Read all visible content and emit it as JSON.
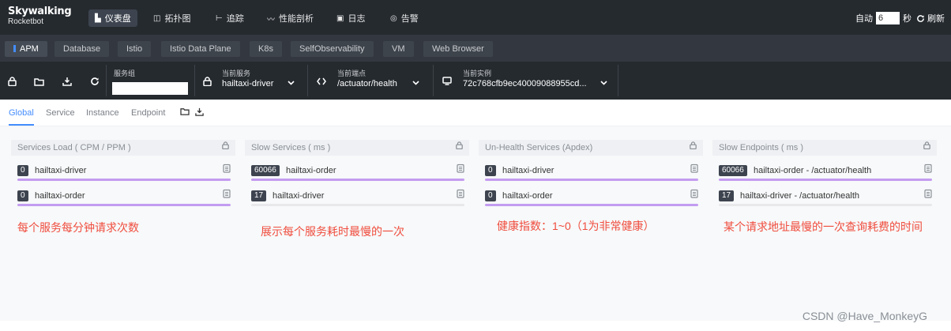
{
  "app": {
    "logo_main": "Skywalking",
    "logo_sub": "Rocketbot"
  },
  "nav": [
    {
      "icon": "▙",
      "label": "仪表盘",
      "active": true
    },
    {
      "icon": "◫",
      "label": "拓扑图",
      "active": false
    },
    {
      "icon": "⊢",
      "label": "追踪",
      "active": false
    },
    {
      "icon": "〰",
      "label": "性能剖析",
      "active": false
    },
    {
      "icon": "▣",
      "label": "日志",
      "active": false
    },
    {
      "icon": "◎",
      "label": "告警",
      "active": false
    }
  ],
  "auto_refresh": {
    "label": "自动",
    "interval": "6",
    "unit": "秒",
    "refresh_label": "刷新"
  },
  "layers": [
    "APM",
    "Database",
    "Istio",
    "Istio Data Plane",
    "K8s",
    "SelfObservability",
    "VM",
    "Web Browser"
  ],
  "selectors": {
    "group_label": "服务组",
    "group_value": "",
    "service_label": "当前服务",
    "service_value": "hailtaxi-driver",
    "endpoint_label": "当前端点",
    "endpoint_value": "/actuator/health",
    "instance_label": "当前实例",
    "instance_value": "72c768cfb9ec40009088955cd..."
  },
  "dashboard_tabs": [
    "Global",
    "Service",
    "Instance",
    "Endpoint"
  ],
  "panels": [
    {
      "title": "Services Load ( CPM / PPM )",
      "rows": [
        {
          "badge": "0",
          "name": "hailtaxi-driver",
          "bar": 1.0
        },
        {
          "badge": "0",
          "name": "hailtaxi-order",
          "bar": 1.0
        }
      ]
    },
    {
      "title": "Slow Services ( ms )",
      "rows": [
        {
          "badge": "60066",
          "name": "hailtaxi-order",
          "bar": 1.0
        },
        {
          "badge": "17",
          "name": "hailtaxi-driver",
          "bar": 0.0
        }
      ]
    },
    {
      "title": "Un-Health Services (Apdex)",
      "rows": [
        {
          "badge": "0",
          "name": "hailtaxi-driver",
          "bar": 1.0
        },
        {
          "badge": "0",
          "name": "hailtaxi-order",
          "bar": 1.0
        }
      ]
    },
    {
      "title": "Slow Endpoints ( ms )",
      "rows": [
        {
          "badge": "60066",
          "name": "hailtaxi-order - /actuator/health",
          "bar": 1.0
        },
        {
          "badge": "17",
          "name": "hailtaxi-driver - /actuator/health",
          "bar": 0.0
        }
      ]
    }
  ],
  "annotations": [
    "每个服务每分钟请求次数",
    "展示每个服务耗时最慢的一次",
    "健康指数：1~0（1为非常健康）",
    "某个请求地址最慢的一次查询耗费的时间"
  ],
  "watermark": "CSDN @Have_MonkeyG",
  "colors": {
    "accent": "#448dfe",
    "bar": "#c49cf0",
    "note": "#f04d3e",
    "dark": "#252a2f"
  }
}
